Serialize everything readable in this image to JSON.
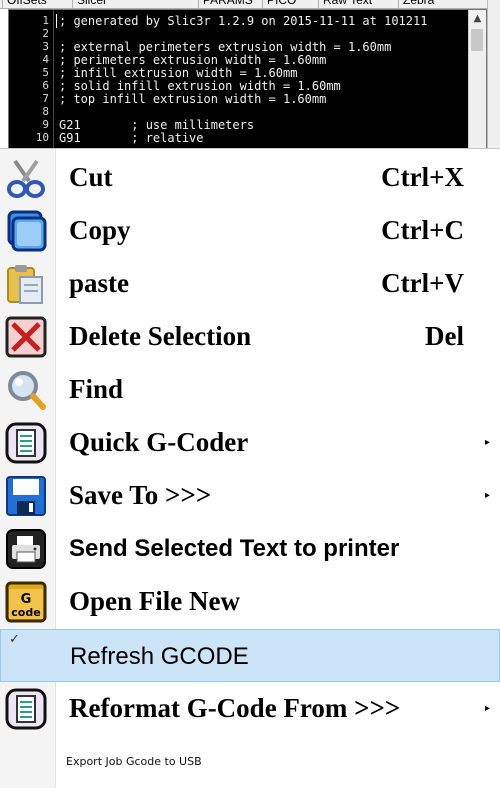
{
  "tabs": [
    "OffSets",
    "Slicer",
    "PARAMS",
    "PICO",
    "Raw Text",
    "Zebra"
  ],
  "editor": {
    "line_numbers": [
      "1",
      "2",
      "3",
      "4",
      "5",
      "6",
      "7",
      "8",
      "9",
      "10"
    ],
    "lines": [
      "; generated by Slic3r 1.2.9 on 2015-11-11 at 101211",
      "",
      "; external perimeters extrusion width = 1.60mm",
      "; perimeters extrusion width = 1.60mm",
      "; infill extrusion width = 1.60mm",
      "; solid infill extrusion width = 1.60mm",
      "; top infill extrusion width = 1.60mm",
      "",
      "G21       ; use millimeters",
      "G91       ; relative"
    ],
    "scroll_up": "▲"
  },
  "menu": {
    "items": [
      {
        "label": "Cut",
        "shortcut": "Ctrl+X",
        "icon": "scissors-icon"
      },
      {
        "label": "Copy",
        "shortcut": "Ctrl+C",
        "icon": "copy-icon"
      },
      {
        "label": "paste",
        "shortcut": "Ctrl+V",
        "icon": "paste-icon"
      },
      {
        "label": "Delete Selection",
        "shortcut": "Del",
        "icon": "delete-icon"
      },
      {
        "label": "Find",
        "shortcut": "",
        "icon": "magnifier-icon"
      },
      {
        "label": "Quick G-Coder",
        "arrow": "▸",
        "icon": "document-icon"
      },
      {
        "label": "Save To >>>",
        "arrow": "▸",
        "icon": "floppy-icon"
      },
      {
        "label": "Send Selected Text to printer",
        "icon": "printer-icon"
      },
      {
        "label": "Open File New",
        "icon": "gcode-folder-icon",
        "icon_text": [
          "G",
          "code"
        ]
      },
      {
        "label": "Refresh GCODE",
        "checked": true,
        "check": "✓"
      },
      {
        "label": "Reformat G-Code From >>>",
        "arrow": "▸",
        "icon": "document-icon"
      },
      {
        "label": "Export Job Gcode to USB"
      }
    ]
  },
  "colors": {
    "highlight": "#cce4f7",
    "highlight_border": "#99c9ef",
    "editor_bg": "#000000",
    "editor_text": "#f0f0f0"
  }
}
